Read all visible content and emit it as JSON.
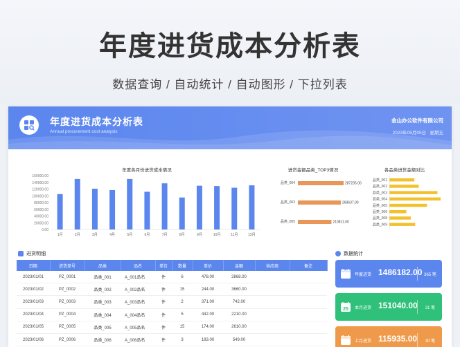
{
  "hero": {
    "title": "年度进货成本分析表",
    "subtitle": "数据查询 / 自动统计 / 自动图形 / 下拉列表"
  },
  "banner": {
    "title": "年度进货成本分析表",
    "subtitle": "Annual procurement cost analysis",
    "company": "金山办公软件有限公司",
    "date": "2023年05月05日",
    "weekday": "星期五",
    "logo_icon": "grid-search-icon"
  },
  "colors": {
    "accent": "#5b86ee",
    "bar_blue": "#5b86ee",
    "bar_orange": "#e8965a",
    "bar_yellow": "#f2c12e",
    "card_blue": "#5b86ee",
    "card_green": "#2fc07a",
    "card_orange": "#ef9a4a"
  },
  "chart_data": [
    {
      "type": "bar",
      "title": "年度各月份进货成本情况",
      "categories": [
        "1月",
        "2月",
        "3月",
        "4月",
        "5月",
        "6月",
        "7月",
        "8月",
        "9月",
        "10月",
        "11月",
        "12月"
      ],
      "values": [
        105000,
        150000,
        121000,
        117000,
        150000,
        112000,
        137000,
        95000,
        130000,
        129000,
        124000,
        131000
      ],
      "ylim": [
        0,
        160000
      ],
      "yticks": [
        "0.00",
        "20000.00",
        "40000.00",
        "60000.00",
        "80000.00",
        "100000.00",
        "120000.00",
        "140000.00",
        "160000.00"
      ],
      "grid": false
    },
    {
      "type": "bar",
      "orientation": "horizontal",
      "title": "进货金额品类_TOP3情况",
      "categories": [
        "品类_004",
        "品类_003",
        "品类_005"
      ],
      "values": [
        287235.0,
        269637.0,
        210811.0
      ],
      "value_labels": [
        "287235.00",
        "269637.00",
        "210811.00"
      ]
    },
    {
      "type": "bar",
      "orientation": "horizontal",
      "title": "各品类进货金额对比",
      "categories": [
        "品类_001",
        "品类_002",
        "品类_003",
        "品类_004",
        "品类_005",
        "品类_006",
        "品类_008",
        "品类_009"
      ],
      "values": [
        140000,
        165000,
        269637,
        287235,
        210811,
        95000,
        120000,
        145000
      ]
    }
  ],
  "table": {
    "section_title": "进货明细",
    "section_icon": "list-icon",
    "headers": [
      "日期",
      "进货单号",
      "品类",
      "品名",
      "单位",
      "数量",
      "单价",
      "金额",
      "供应商",
      "备注"
    ],
    "rows": [
      [
        "2023/01/01",
        "PZ_0001",
        "品类_001",
        "A_001品名",
        "件",
        "6",
        "478.00",
        "2868.00",
        "",
        ""
      ],
      [
        "2023/01/02",
        "PZ_0002",
        "品类_002",
        "A_002品名",
        "件",
        "15",
        "244.00",
        "3660.00",
        "",
        ""
      ],
      [
        "2023/01/03",
        "PZ_0003",
        "品类_003",
        "A_003品名",
        "件",
        "2",
        "371.00",
        "742.00",
        "",
        ""
      ],
      [
        "2023/01/04",
        "PZ_0004",
        "品类_004",
        "A_004品名",
        "件",
        "5",
        "442.00",
        "2210.00",
        "",
        ""
      ],
      [
        "2023/01/05",
        "PZ_0005",
        "品类_005",
        "A_005品名",
        "件",
        "15",
        "174.00",
        "2610.00",
        "",
        ""
      ],
      [
        "2023/01/06",
        "PZ_0006",
        "品类_006",
        "A_006品名",
        "件",
        "3",
        "183.00",
        "549.00",
        "",
        ""
      ],
      [
        "2023/01/07",
        "PZ_0007",
        "品类_007",
        "A_007品名",
        "件",
        "12",
        "234.00",
        "2808.00",
        "",
        ""
      ]
    ]
  },
  "stats": {
    "section_title": "数据统计",
    "section_icon": "stats-icon",
    "cards": [
      {
        "label": "年度进货",
        "value": "1486182.00",
        "unit": "365 笔",
        "icon": "calendar-icon"
      },
      {
        "label": "本月进货",
        "value": "151040.00",
        "unit": "31 笔",
        "icon": "calendar-25-icon",
        "icon_text": "25"
      },
      {
        "label": "上月进货",
        "value": "115935.00",
        "unit": "30 笔",
        "icon": "calendar-icon"
      }
    ]
  }
}
